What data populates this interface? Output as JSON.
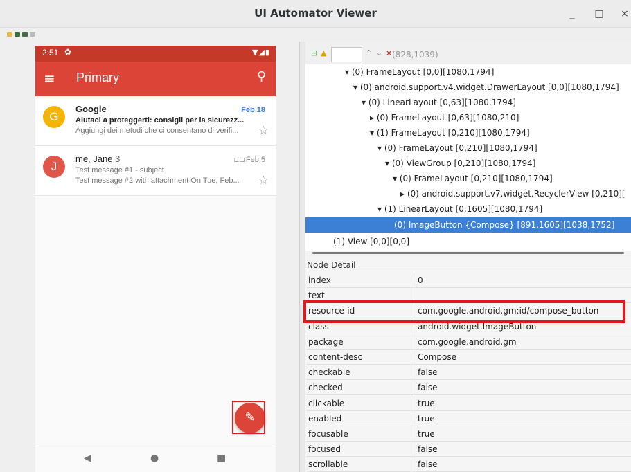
{
  "window": {
    "title": "UI Automator Viewer",
    "min": "_",
    "max": "□",
    "close": "×"
  },
  "phone": {
    "time": "2:51",
    "appbar_title": "Primary",
    "emails": [
      {
        "avatar": "G",
        "avatar_color": "#f4b400",
        "sender": "Google",
        "date": "Feb 18",
        "subject": "Aiutaci a proteggerti: consigli per la sicurezz...",
        "snippet": "Aggiungi dei metodi che ci consentano di verifi..."
      },
      {
        "avatar": "J",
        "avatar_color": "#e0574a",
        "sender": "me, Jane",
        "count": "3",
        "date": "Feb 5",
        "subject": "Test message #1 - subject",
        "snippet": "Test message #2 with attachment On Tue, Feb..."
      }
    ]
  },
  "tree": {
    "coords": "(828,1039)",
    "nodes": [
      {
        "label": "(0) FrameLayout [0,0][1080,1794]",
        "arrow": "▾"
      },
      {
        "label": "(0) android.support.v4.widget.DrawerLayout [0,0][1080,1794]",
        "arrow": "▾"
      },
      {
        "label": "(0) LinearLayout [0,63][1080,1794]",
        "arrow": "▾"
      },
      {
        "label": "(0) FrameLayout [0,63][1080,210]",
        "arrow": "▸"
      },
      {
        "label": "(1) FrameLayout [0,210][1080,1794]",
        "arrow": "▾"
      },
      {
        "label": "(0) FrameLayout [0,210][1080,1794]",
        "arrow": "▾"
      },
      {
        "label": "(0) ViewGroup [0,210][1080,1794]",
        "arrow": "▾"
      },
      {
        "label": "(0) FrameLayout [0,210][1080,1794]",
        "arrow": "▾"
      },
      {
        "label": "(0) android.support.v7.widget.RecyclerView [0,210][",
        "arrow": "▸"
      },
      {
        "label": "(1) LinearLayout [0,1605][1080,1794]",
        "arrow": "▾"
      },
      {
        "label": "(0) ImageButton {Compose} [891,1605][1038,1752]",
        "arrow": ""
      },
      {
        "label": "(1) View [0,0][0,0]",
        "arrow": ""
      }
    ]
  },
  "detail": {
    "title": "Node Detail",
    "props": [
      {
        "k": "index",
        "v": "0"
      },
      {
        "k": "text",
        "v": ""
      },
      {
        "k": "resource-id",
        "v": "com.google.android.gm:id/compose_button"
      },
      {
        "k": "class",
        "v": "android.widget.ImageButton"
      },
      {
        "k": "package",
        "v": "com.google.android.gm"
      },
      {
        "k": "content-desc",
        "v": "Compose"
      },
      {
        "k": "checkable",
        "v": "false"
      },
      {
        "k": "checked",
        "v": "false"
      },
      {
        "k": "clickable",
        "v": "true"
      },
      {
        "k": "enabled",
        "v": "true"
      },
      {
        "k": "focusable",
        "v": "true"
      },
      {
        "k": "focused",
        "v": "false"
      },
      {
        "k": "scrollable",
        "v": "false"
      }
    ]
  }
}
